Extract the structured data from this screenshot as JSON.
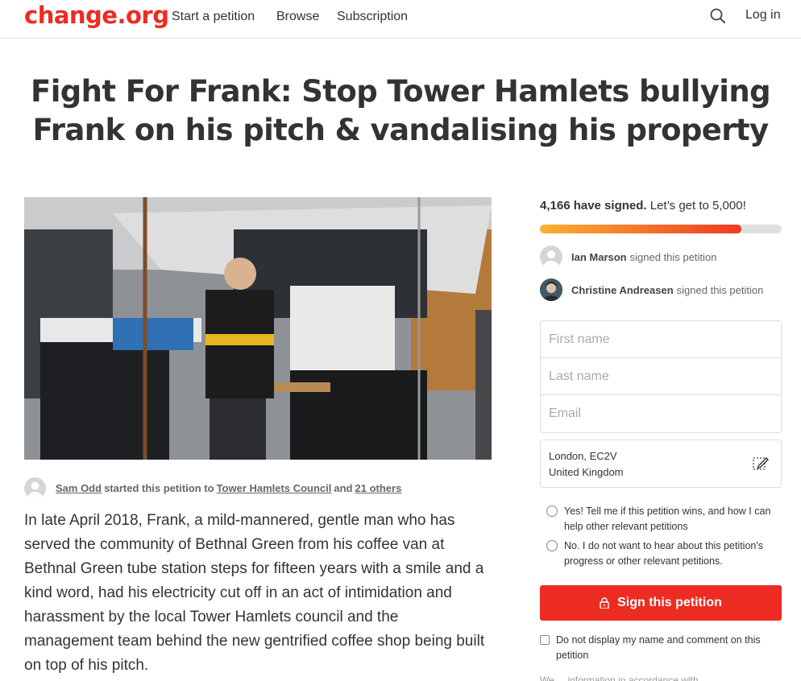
{
  "header": {
    "logo": "change.org",
    "nav": [
      "Start a petition",
      "Browse",
      "Subscription"
    ],
    "login": "Log in"
  },
  "petition": {
    "title": "Fight For Frank: Stop Tower Hamlets bullying Frank on his pitch & vandalising his property",
    "starter": {
      "name": "Sam Odd",
      "text1": "started this petition to",
      "target": "Tower Hamlets Council",
      "and": "and",
      "others": "21 others"
    },
    "body": "In late April 2018, Frank, a mild-mannered, gentle man who has served the community of Bethnal Green from his coffee van at Bethnal Green tube station steps for fifteen years with a smile and a kind word, had his electricity cut off in an act of intimidation and harassment by the local Tower Hamlets council and the management team behind the new gentrified coffee shop being built on top of his pitch."
  },
  "sidebar": {
    "count_bold": "4,166 have signed.",
    "count_rest": "Let’s get to 5,000!",
    "progress": 0.8332,
    "signers": [
      {
        "name": "Ian Marson",
        "action": "signed this petition"
      },
      {
        "name": "Christine Andreasen",
        "action": "signed this petition"
      }
    ],
    "form": {
      "first_name_placeholder": "First name",
      "last_name_placeholder": "Last name",
      "email_placeholder": "Email"
    },
    "location_line1": "London, EC2V",
    "location_line2": "United Kingdom",
    "option_yes": "Yes! Tell me if this petition wins, and how I can help other relevant petitions",
    "option_no": "No. I do not want to hear about this petition's progress or other relevant petitions.",
    "sign_button": "Sign this petition",
    "hide_name": "Do not display my name and comment on this petition",
    "footnote": "We ... information in accordance with"
  },
  "colors": {
    "brand": "#ec2c22",
    "progress_start": "#f9b233",
    "progress_end": "#ef3a23"
  }
}
